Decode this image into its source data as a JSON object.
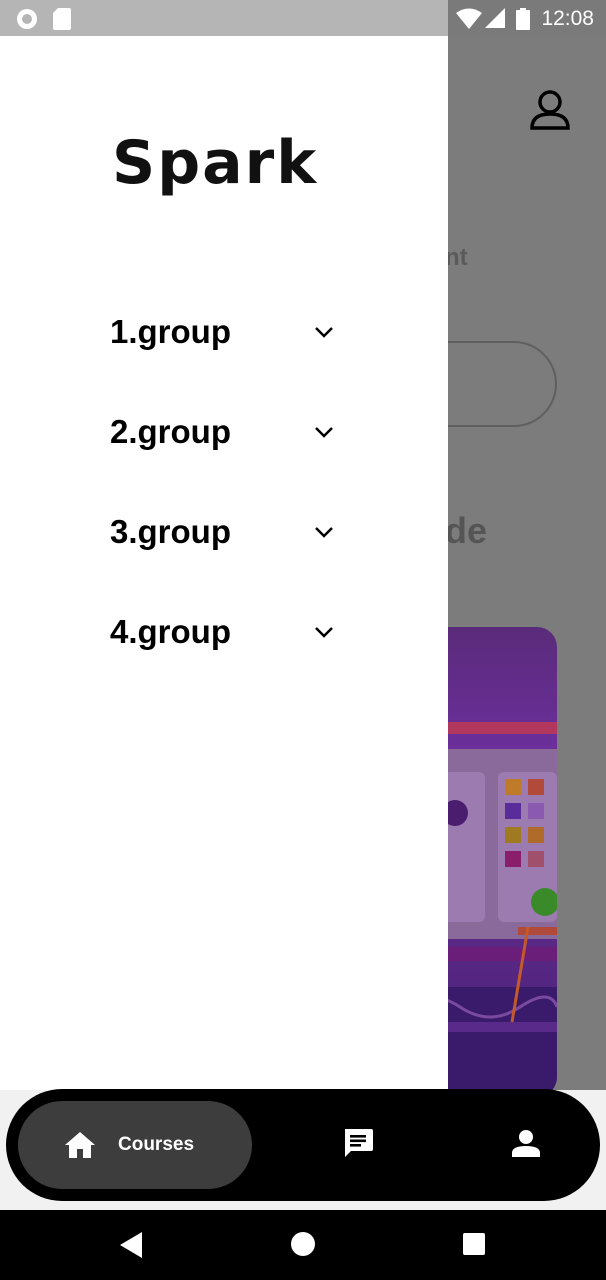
{
  "status_bar": {
    "time": "12:08",
    "icons": [
      "circle-icon",
      "sd-card-icon",
      "wifi-icon",
      "signal-icon",
      "battery-icon"
    ]
  },
  "background": {
    "text_fragment_1": "nt",
    "text_fragment_2": "de",
    "icons": [
      "account-icon"
    ]
  },
  "drawer": {
    "logo": "Spark",
    "groups": [
      {
        "label": "1.group"
      },
      {
        "label": "2.group"
      },
      {
        "label": "3.group"
      },
      {
        "label": "4.group"
      }
    ],
    "expand_icon": "chevron-down-icon"
  },
  "bottom_nav": {
    "items": [
      {
        "label": "Courses",
        "icon": "home-icon",
        "active": true
      },
      {
        "label": "",
        "icon": "chat-icon",
        "active": false
      },
      {
        "label": "",
        "icon": "profile-icon",
        "active": false
      }
    ]
  },
  "system_nav": {
    "icons": [
      "back-icon",
      "home-circle-icon",
      "recents-icon"
    ]
  }
}
